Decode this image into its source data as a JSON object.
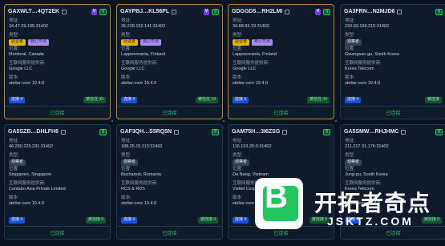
{
  "cards": [
    {
      "id": "GAXWLT…4QT2EK",
      "ip": "34.47.29.195:31402",
      "location": "Montreal, Canada",
      "provider": "Google LLC",
      "version": "stellar-core 19.4.0",
      "tags": [
        "验证者",
        "核心节点"
      ],
      "badges": [
        "V",
        "0"
      ],
      "peers": "连接 4",
      "score": "被信任 35",
      "status": "已连接",
      "selected": true
    },
    {
      "id": "GAYPBJ…KL56PL",
      "ip": "35.228.152.141:31402",
      "location": "Lappeenranta, Finland",
      "provider": "Google LLC",
      "version": "stellar-core 19.4.0",
      "tags": [
        "验证者",
        "核心节点"
      ],
      "badges": [
        "V",
        "0"
      ],
      "peers": "连接 4",
      "score": "被信任 19",
      "status": "已连接",
      "selected": true
    },
    {
      "id": "GDGGD5…RH2LMI",
      "ip": "34.88.93.19:31402",
      "location": "Lappeenranta, Finland",
      "provider": "Google LLC",
      "version": "stellar-core 19.4.0",
      "tags": [
        "验证者",
        "核心节点"
      ],
      "badges": [
        "V",
        "0"
      ],
      "peers": "连接 4",
      "score": "被信任 34",
      "status": "已连接",
      "selected": true
    },
    {
      "id": "GA3FRN…N2MJD6",
      "ip": "220.83.199.215:31402",
      "location": "Gwangsan-gu, South Korea",
      "provider": "Korea Telecom",
      "version": "stellar-core 19.4.0",
      "tags": [
        "观察者"
      ],
      "badges": [
        "0"
      ],
      "peers": "连接 4",
      "score": "被连接",
      "status": "已连接",
      "selected": false
    },
    {
      "id": "GA5SZB…DHLFH6",
      "ip": "46.250.225.231:31402",
      "location": "Singapore, Singapore",
      "provider": "Contabo Asia Private Limited",
      "version": "stellar-core 19.4.0",
      "tags": [
        "观察者"
      ],
      "badges": [
        "0"
      ],
      "peers": "连接 4",
      "score": "被连接 0",
      "status": "已连接",
      "selected": false
    },
    {
      "id": "GAF3QH…S5RQ5N",
      "ip": "188.25.15.113:31402",
      "location": "Bucharest, Romania",
      "provider": "RCS & RDS",
      "version": "stellar-core 19.4.0",
      "tags": [
        "观察者"
      ],
      "badges": [
        "0"
      ],
      "peers": "连接 4",
      "score": "被连接 0",
      "status": "已连接",
      "selected": false
    },
    {
      "id": "GAM75H…3I6ZSG",
      "ip": "116.103.20.0:31402",
      "location": "Da Nang, Vietnam",
      "provider": "Viettel Corporation",
      "version": "stellar-core 19.4.0",
      "tags": [
        "观察者"
      ],
      "badges": [
        "0"
      ],
      "peers": "连接 4",
      "score": "被连接 0",
      "status": "已连接",
      "selected": false
    },
    {
      "id": "GA5SMW…RHJHMC",
      "ip": "211.217.31.176:31402",
      "location": "Jung-gu, South Korea",
      "provider": "Korea Telecom",
      "version": "stellar-core 19.4.0",
      "tags": [
        "观察者"
      ],
      "badges": [
        "0"
      ],
      "peers": "连接 4",
      "score": "被连接 0",
      "status": "已连接",
      "selected": false
    }
  ],
  "labels": {
    "address": "地址:",
    "type": "类型:",
    "location": "位置:",
    "provider": "互联网服务提供商:",
    "version": "版本:"
  },
  "watermark": {
    "brand": "开拓者奇点",
    "domain": "JSKTZ.COM",
    "logo_letter": "B"
  }
}
